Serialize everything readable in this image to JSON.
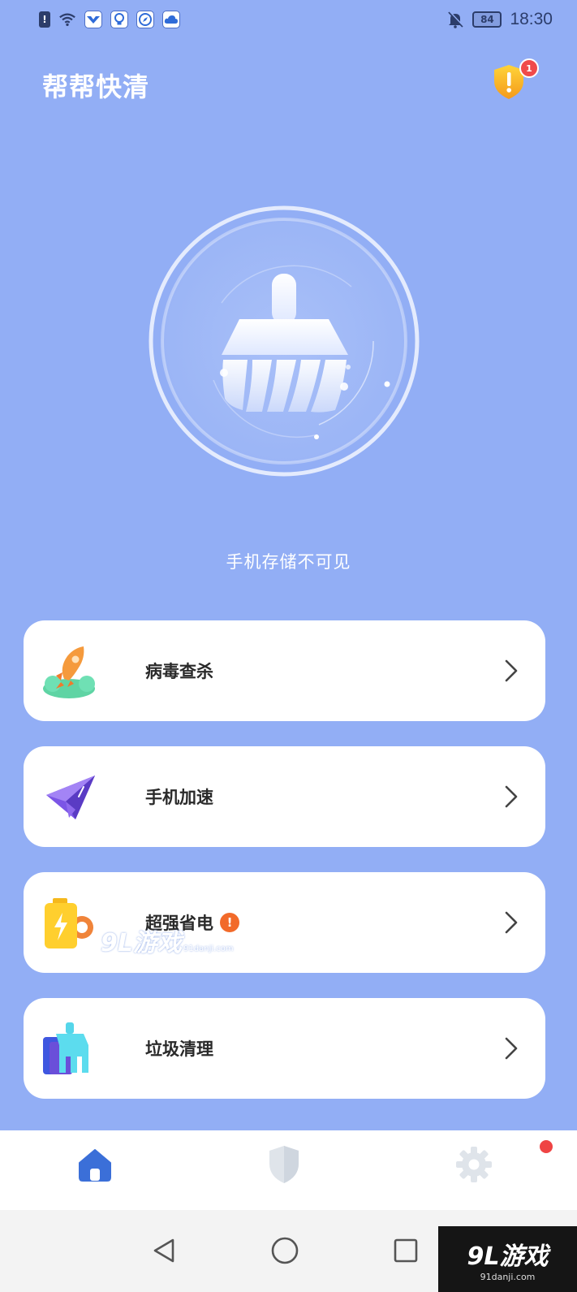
{
  "status_bar": {
    "time": "18:30",
    "battery": "84",
    "icons": [
      "sim-icon",
      "wifi-icon",
      "app-notification-icon",
      "bulb-icon",
      "compass-icon",
      "cloud-icon",
      "bell-muted-icon"
    ]
  },
  "header": {
    "title": "帮帮快清",
    "alert_count": "1"
  },
  "main": {
    "storage_text": "手机存储不可见"
  },
  "features": [
    {
      "label": "病毒查杀",
      "icon": "rocket-icon"
    },
    {
      "label": "手机加速",
      "icon": "paper-plane-icon"
    },
    {
      "label": "超强省电",
      "icon": "battery-icon",
      "warning": "!"
    },
    {
      "label": "垃圾清理",
      "icon": "trash-clean-icon"
    }
  ],
  "bottom_nav": {
    "items": [
      "home-icon",
      "shield-icon",
      "gear-icon"
    ],
    "active": "home-icon"
  },
  "watermark": {
    "mid_text": "9L游戏",
    "mid_sub": "91danji.com",
    "corner_text": "9L游戏",
    "corner_sub": "91danji.com"
  },
  "colors": {
    "background": "#92aef5",
    "accent": "#3b6fd8",
    "warning": "#f26a2a",
    "badge": "#f04a4a"
  }
}
